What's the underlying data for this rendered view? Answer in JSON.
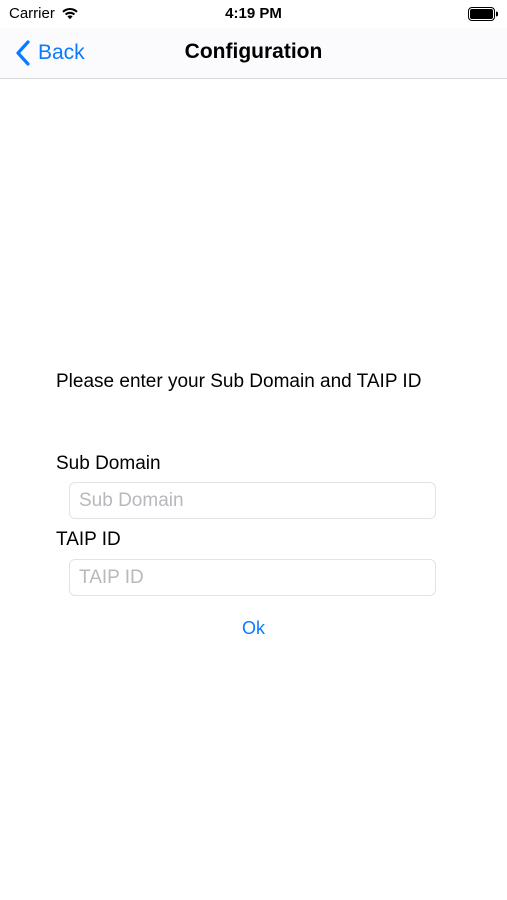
{
  "status_bar": {
    "carrier": "Carrier",
    "time": "4:19 PM",
    "wifi_icon": "wifi-icon",
    "battery_icon": "battery-icon"
  },
  "nav": {
    "back_label": "Back",
    "back_icon": "chevron-left-icon",
    "title": "Configuration"
  },
  "form": {
    "prompt": "Please enter your Sub Domain and TAIP ID",
    "sub_domain": {
      "label": "Sub Domain",
      "value": "",
      "placeholder": "Sub Domain"
    },
    "taip_id": {
      "label": "TAIP ID",
      "value": "",
      "placeholder": "TAIP ID"
    },
    "ok_label": "Ok"
  },
  "colors": {
    "accent": "#0a7aff",
    "placeholder": "#b8b8bd",
    "separator": "#d9d9dc"
  }
}
